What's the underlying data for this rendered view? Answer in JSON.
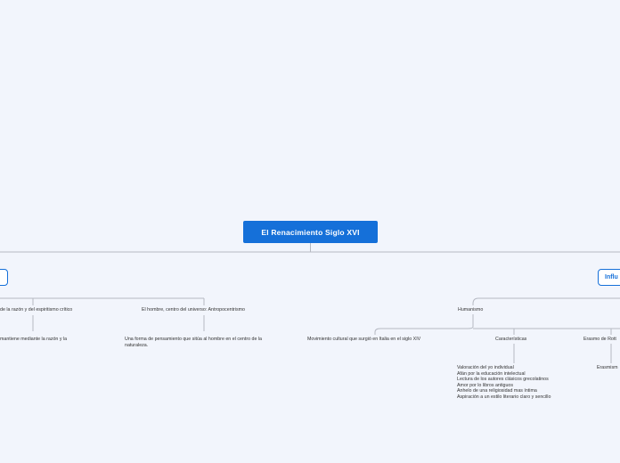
{
  "root": {
    "label": "El Renacimiento Siglo XVI"
  },
  "left": {
    "branch_label": "",
    "topic_reason": "de la razón y del espiritismo crítico",
    "topic_reason_child": "mantiene mediante la razón y la",
    "topic_man": "El hombre, centro del universo: Antropocentrismo",
    "topic_man_child": "Una forma de pensamiento que sitúa al hombre en el centro de la naturaleza."
  },
  "right": {
    "branch_label": "Influ",
    "humanism": "Humanismo",
    "movement": "Movimiento cultural que surgió en Italia en el siglo XIV",
    "characteristics": "Características",
    "characteristics_list": [
      "Valoración del yo individual",
      "Afán por la educación intelectual",
      "Lectura de los autores clásicos grecolatinos",
      "Amor por lo libros antiguos",
      "Anhelo de una religiosidad mas íntima",
      "Aspiración a un estilo literario claro y sencillo"
    ],
    "erasmus": "Erasmo de Rott",
    "erasmus_child": "Erasmism"
  }
}
